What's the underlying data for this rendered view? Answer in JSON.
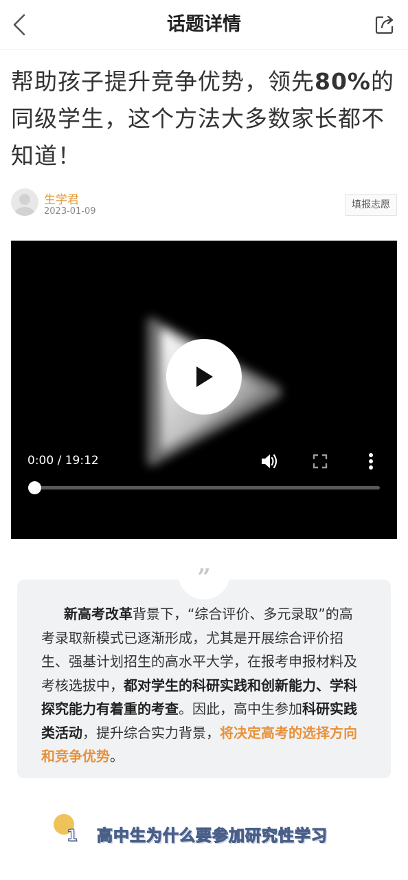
{
  "header": {
    "title": "话题详情"
  },
  "article": {
    "title_parts": [
      "帮助孩子提升竞争优势，领先",
      "80%",
      "的同级学生，这个方法大多数家长都不知道！"
    ]
  },
  "author": {
    "name": "生学君",
    "date": "2023-01-09",
    "tag_button": "填报志愿"
  },
  "video": {
    "time": "0:00 / 19:12",
    "progress": 0.0,
    "icons": [
      "play-icon",
      "volume-icon",
      "fullscreen-icon",
      "more-vert-icon"
    ]
  },
  "quote": {
    "mark": "”",
    "parts": [
      {
        "text": "新高考改革",
        "style": "bold"
      },
      {
        "text": "背景下，“综合评价、多元录取”的高考录取新模式已逐渐形成，尤其是开展综合评价招生、强基计划招生的高水平大学，在报考申报材料及考核选拔中，",
        "style": "normal"
      },
      {
        "text": "都对学生的科研实践和创新能力、学科探究能力有着重的考查",
        "style": "bold"
      },
      {
        "text": "。因此，高中生参加",
        "style": "normal"
      },
      {
        "text": "科研实践类活动",
        "style": "bold"
      },
      {
        "text": "，提升综合实力背景，",
        "style": "normal"
      },
      {
        "text": "将决定高考的选择方向和竞争优势",
        "style": "orange"
      },
      {
        "text": "。",
        "style": "normal"
      }
    ]
  },
  "section": {
    "number": "1",
    "title": "高中生为什么要参加研究性学习"
  },
  "colors": {
    "accent_orange": "#e8913a",
    "author_orange": "#e59a3a",
    "quote_bg": "#f1f2f4",
    "dot_yellow": "#f0c25a"
  }
}
